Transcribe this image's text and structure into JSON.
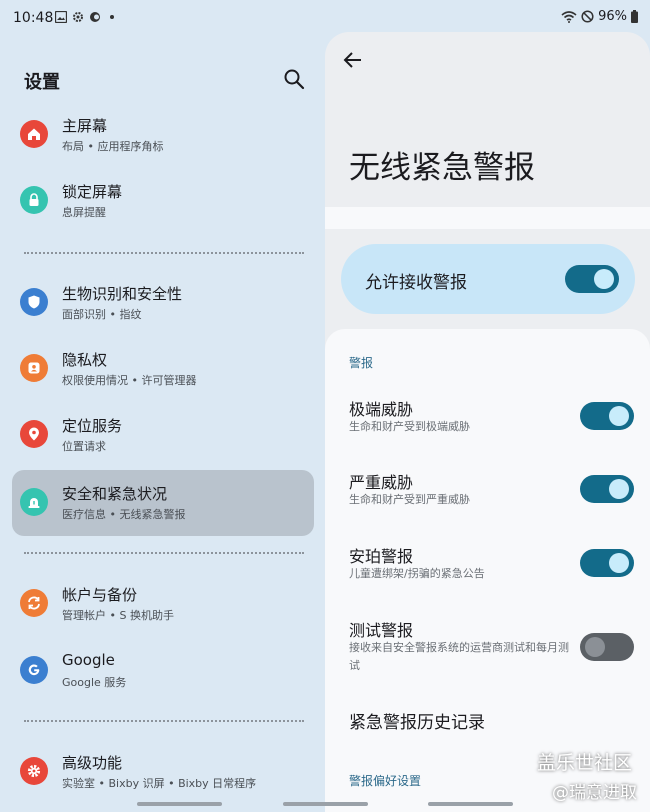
{
  "status_bar": {
    "time": "10:48",
    "battery": "96%"
  },
  "left_pane": {
    "title": "设置",
    "items": [
      {
        "title": "主屏幕",
        "subtitle": "布局 • 应用程序角标",
        "icon": "home-icon",
        "color": "#e8473a"
      },
      {
        "title": "锁定屏幕",
        "subtitle": "息屏提醒",
        "icon": "lock-icon",
        "color": "#35c4b0"
      },
      {
        "title": "生物识别和安全性",
        "subtitle": "面部识别 • 指纹",
        "icon": "shield-icon",
        "color": "#3b7fd0"
      },
      {
        "title": "隐私权",
        "subtitle": "权限使用情况 • 许可管理器",
        "icon": "privacy-icon",
        "color": "#ef7c36"
      },
      {
        "title": "定位服务",
        "subtitle": "位置请求",
        "icon": "location-icon",
        "color": "#e8473a"
      },
      {
        "title": "安全和紧急状况",
        "subtitle": "医疗信息 • 无线紧急警报",
        "icon": "emergency-icon",
        "color": "#35c4b0"
      },
      {
        "title": "帐户与备份",
        "subtitle": "管理帐户 • S 换机助手",
        "icon": "sync-icon",
        "color": "#ef7c36"
      },
      {
        "title": "Google",
        "subtitle": "Google 服务",
        "icon": "google-icon",
        "color": "#3b7fd0"
      },
      {
        "title": "高级功能",
        "subtitle": "实验室 • Bixby 识屏 • Bixby 日常程序",
        "icon": "gear-icon",
        "color": "#e8473a"
      }
    ]
  },
  "right_pane": {
    "title": "无线紧急警报",
    "master_toggle": {
      "label": "允许接收警报",
      "on": true
    },
    "section_alerts": "警报",
    "items": [
      {
        "title": "极端威胁",
        "subtitle": "生命和财产受到极端威胁",
        "on": true
      },
      {
        "title": "严重威胁",
        "subtitle": "生命和财产受到严重威胁",
        "on": true
      },
      {
        "title": "安珀警报",
        "subtitle": "儿童遭绑架/拐骗的紧急公告",
        "on": true
      },
      {
        "title": "测试警报",
        "subtitle": "接收来自安全警报系统的运营商测试和每月测试",
        "on": false
      }
    ],
    "history": "紧急警报历史记录",
    "section_prefs": "警报偏好设置"
  },
  "watermark": {
    "line1": "盖乐世社区",
    "line2": "@瑞意进取"
  }
}
